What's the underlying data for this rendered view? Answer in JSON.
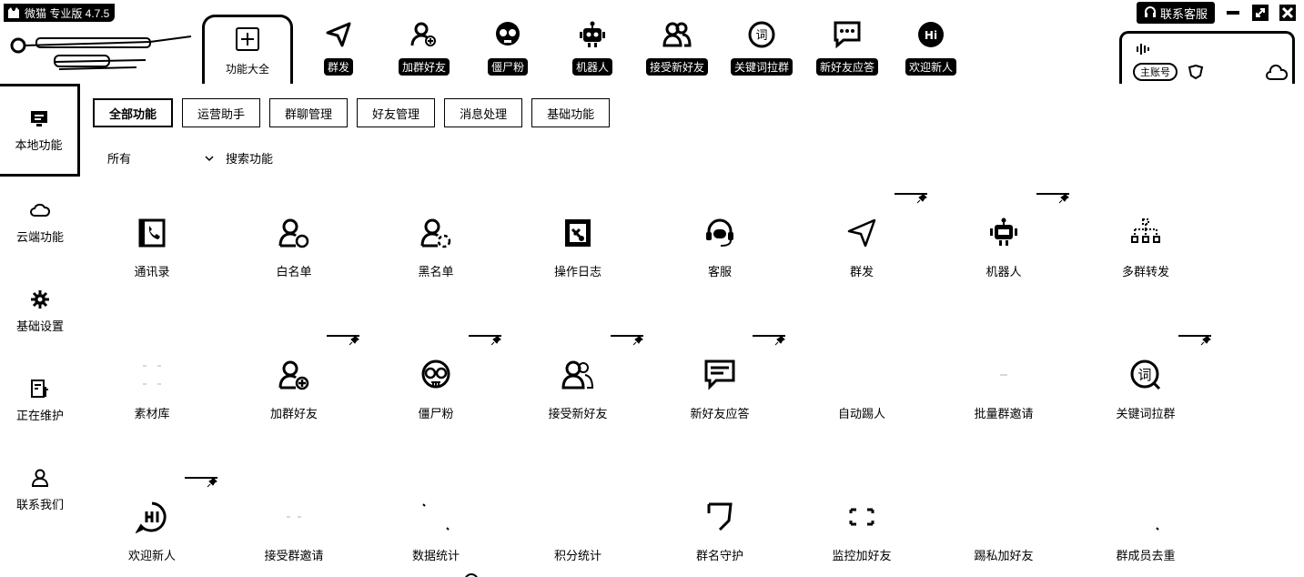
{
  "app": {
    "title": "微猫 专业版 4.7.5"
  },
  "top_tab": {
    "label": "功能大全",
    "icon": "grid-plus-icon"
  },
  "toolbar": [
    {
      "label": "群发",
      "icon": "send-icon"
    },
    {
      "label": "加群好友",
      "icon": "add-user-icon"
    },
    {
      "label": "僵尸粉",
      "icon": "skull-icon"
    },
    {
      "label": "机器人",
      "icon": "robot-icon"
    },
    {
      "label": "接受新好友",
      "icon": "users-icon"
    },
    {
      "label": "关键词拉群",
      "icon": "keyword-icon"
    },
    {
      "label": "新好友应答",
      "icon": "chat-reply-icon"
    },
    {
      "label": "欢迎新人",
      "icon": "hi-icon"
    }
  ],
  "window": {
    "service_label": "联系客服"
  },
  "account": {
    "badge": "主账号"
  },
  "sidebar": [
    {
      "label": "本地功能",
      "icon": "monitor-icon",
      "active": true
    },
    {
      "label": "云端功能",
      "icon": "cloud-icon"
    },
    {
      "label": "基础设置",
      "icon": "gear-icon"
    },
    {
      "label": "正在维护",
      "icon": "maintenance-icon"
    },
    {
      "label": "联系我们",
      "icon": "person-icon"
    }
  ],
  "categories": [
    "全部功能",
    "运营助手",
    "群聊管理",
    "好友管理",
    "消息处理",
    "基础功能"
  ],
  "filter": {
    "selected": "所有",
    "search_placeholder": "搜索功能"
  },
  "features": [
    {
      "label": "通讯录",
      "icon": "contacts-icon",
      "pinned": false
    },
    {
      "label": "白名单",
      "icon": "whitelist-icon",
      "pinned": false
    },
    {
      "label": "黑名单",
      "icon": "blacklist-icon",
      "pinned": false
    },
    {
      "label": "操作日志",
      "icon": "log-icon",
      "pinned": false
    },
    {
      "label": "客服",
      "icon": "headset-icon",
      "pinned": false
    },
    {
      "label": "群发",
      "icon": "send-icon",
      "pinned": true
    },
    {
      "label": "机器人",
      "icon": "robot-icon",
      "pinned": true
    },
    {
      "label": "多群转发",
      "icon": "forward-icon",
      "pinned": false
    },
    {
      "label": "素材库",
      "icon": "material-icon",
      "pinned": false
    },
    {
      "label": "加群好友",
      "icon": "add-user-icon",
      "pinned": true
    },
    {
      "label": "僵尸粉",
      "icon": "skull-icon",
      "pinned": true
    },
    {
      "label": "接受新好友",
      "icon": "users-icon",
      "pinned": true
    },
    {
      "label": "新好友应答",
      "icon": "chat-reply-icon",
      "pinned": true
    },
    {
      "label": "自动踢人",
      "icon": "kick-icon",
      "pinned": false
    },
    {
      "label": "批量群邀请",
      "icon": "invite-icon",
      "pinned": false
    },
    {
      "label": "关键词拉群",
      "icon": "keyword-icon",
      "pinned": true
    },
    {
      "label": "欢迎新人",
      "icon": "hi-icon",
      "pinned": true
    },
    {
      "label": "接受群邀请",
      "icon": "accept-invite-icon",
      "pinned": false
    },
    {
      "label": "数据统计",
      "icon": "stats-icon",
      "pinned": false
    },
    {
      "label": "积分统计",
      "icon": "points-icon",
      "pinned": false
    },
    {
      "label": "群名守护",
      "icon": "shield-icon",
      "pinned": false
    },
    {
      "label": "监控加好友",
      "icon": "monitor-add-icon",
      "pinned": false
    },
    {
      "label": "踢私加好友",
      "icon": "kick-private-icon",
      "pinned": false
    },
    {
      "label": "群成员去重",
      "icon": "dedupe-icon",
      "pinned": false
    }
  ]
}
